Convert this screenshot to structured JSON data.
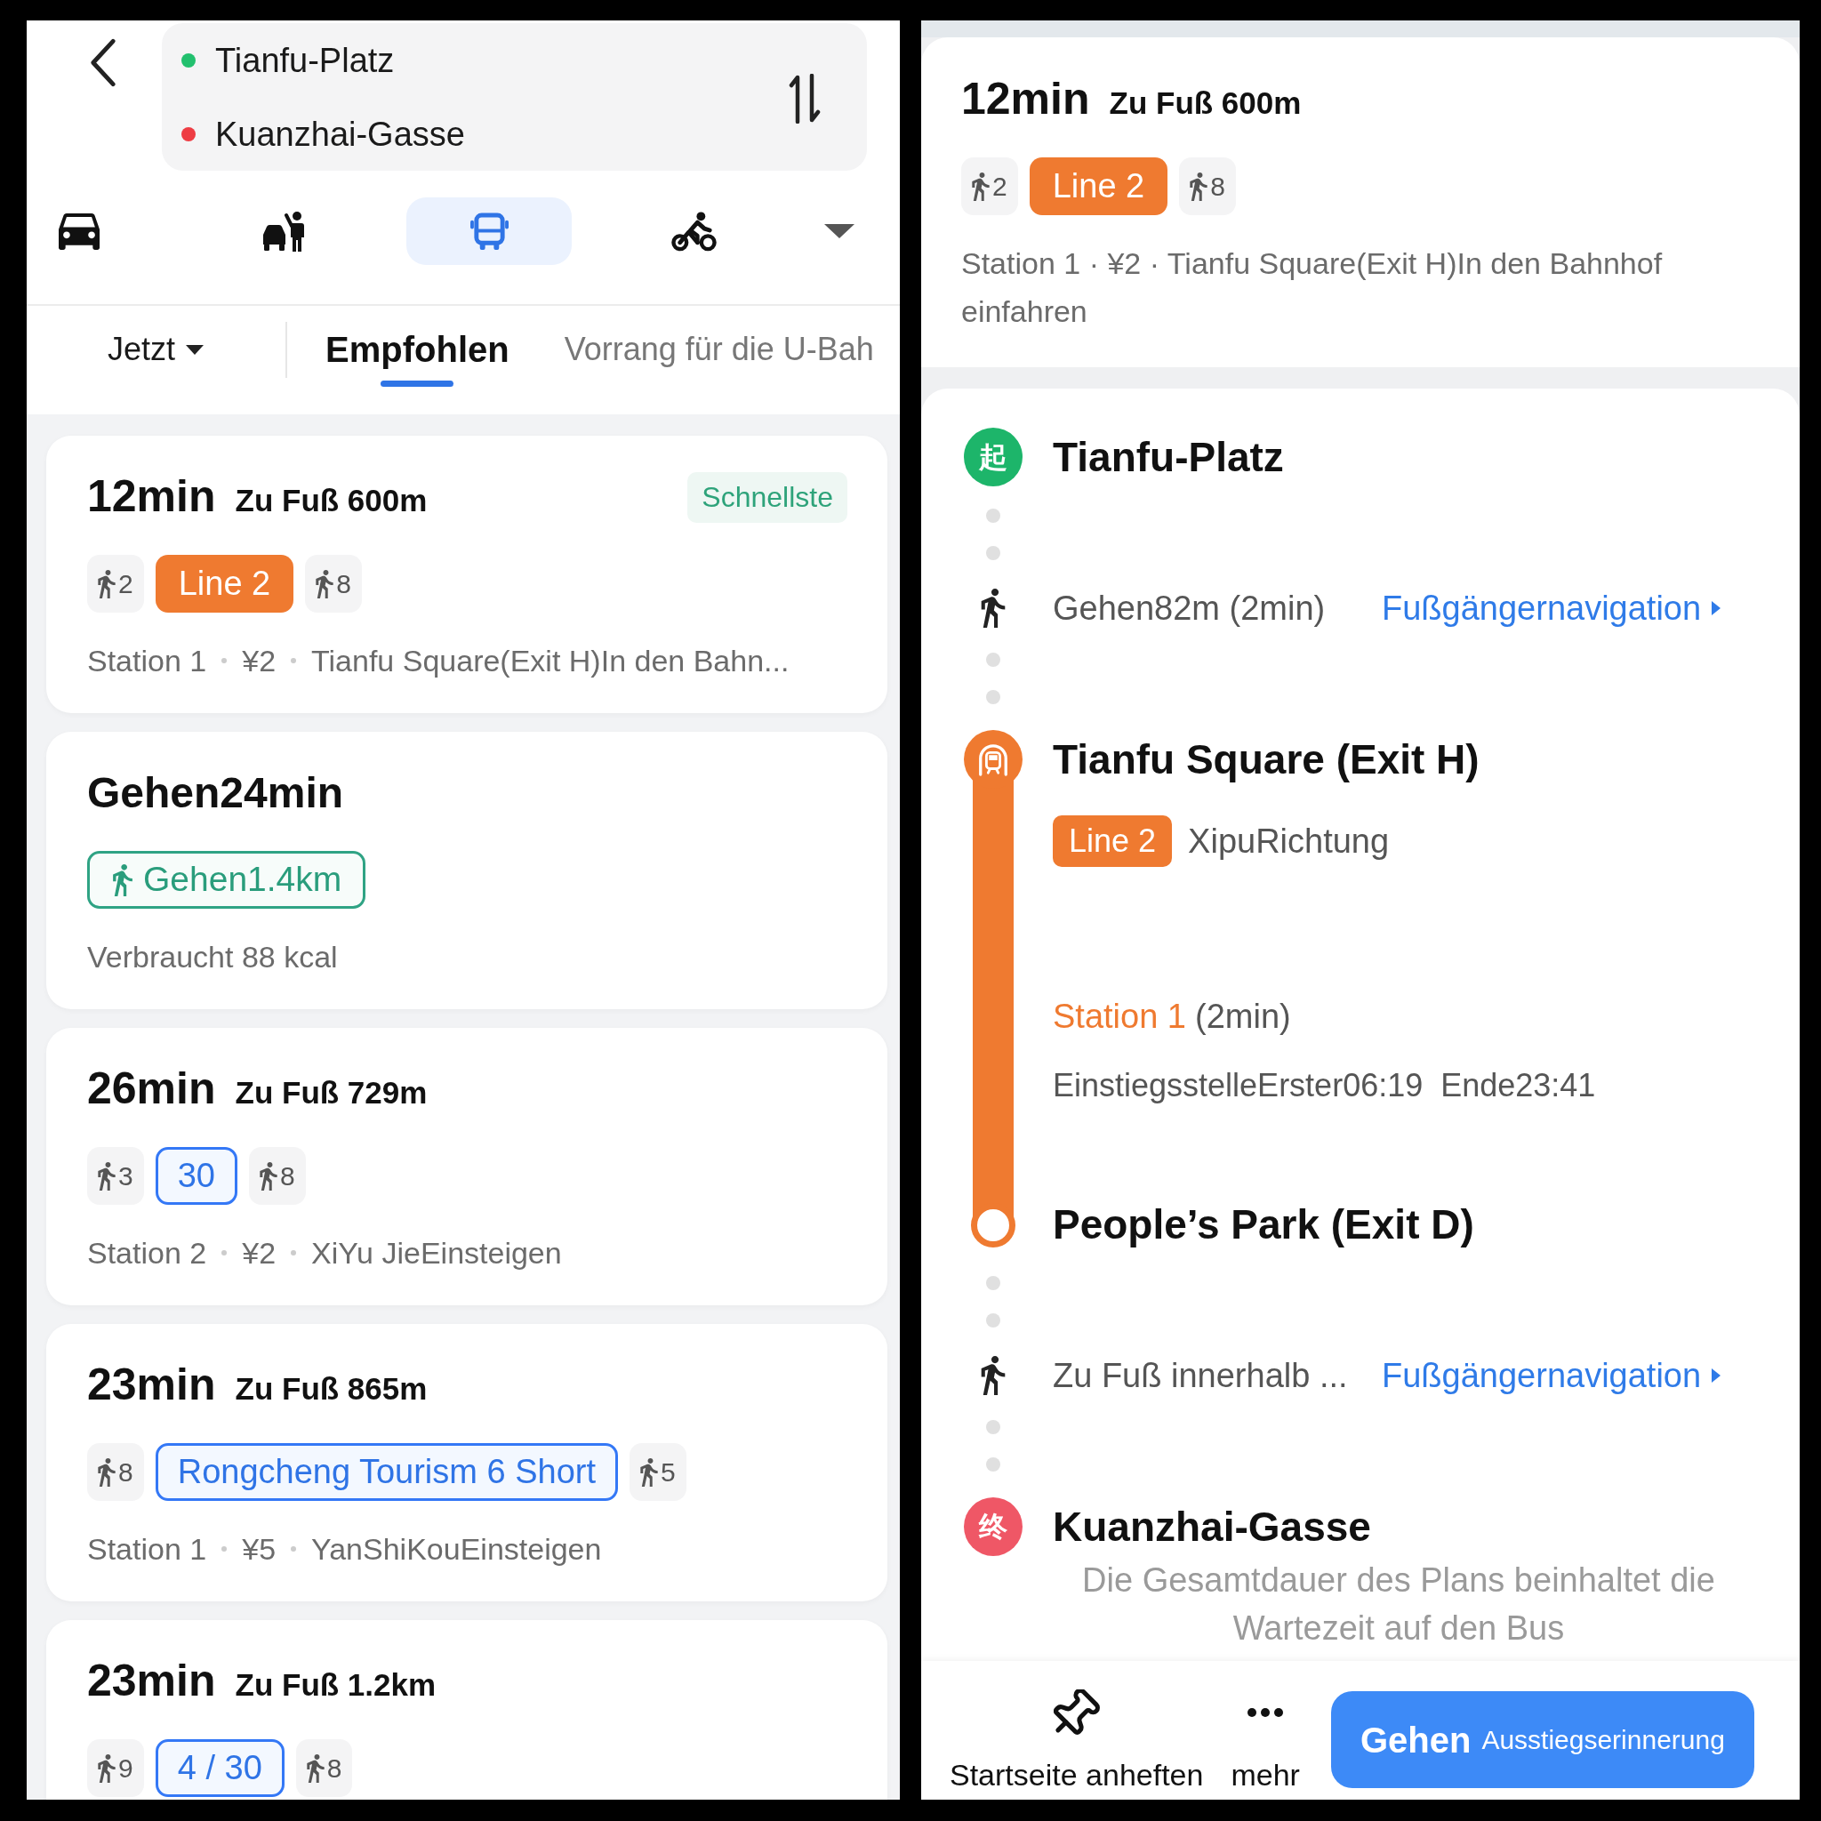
{
  "route_header": {
    "endpoints": [
      {
        "name": "Tianfu-Platz",
        "color": "#22c06e"
      },
      {
        "name": "Kuanzhai-Gasse",
        "color": "#ee3d44"
      }
    ]
  },
  "transport_modes": [
    {
      "kind": "car",
      "selected": false
    },
    {
      "kind": "taxi",
      "selected": false
    },
    {
      "kind": "bus",
      "selected": true
    },
    {
      "kind": "bike",
      "selected": false
    }
  ],
  "time_filter": "Jetzt",
  "sort_tabs": [
    {
      "label": "Empfohlen",
      "selected": true
    },
    {
      "label": "Vorrang für die U-Bah",
      "selected": false
    }
  ],
  "routes": [
    {
      "kind": "transit",
      "duration": "12min",
      "walk": "Zu Fuß 600m",
      "badge": "Schnellste",
      "segments": [
        {
          "kind": "walk",
          "label": "2"
        },
        {
          "kind": "metro",
          "label": "Line 2"
        },
        {
          "kind": "walk",
          "label": "8"
        }
      ],
      "meta": [
        "Station 1",
        "¥2",
        "Tianfu Square(Exit H)In den Bahn..."
      ]
    },
    {
      "kind": "walk",
      "title": "Gehen24min",
      "distance": "Gehen1.4km",
      "meta": [
        "Verbraucht 88 kcal"
      ]
    },
    {
      "kind": "transit",
      "duration": "26min",
      "walk": "Zu Fuß 729m",
      "segments": [
        {
          "kind": "walk",
          "label": "3"
        },
        {
          "kind": "bus",
          "label": "30"
        },
        {
          "kind": "walk",
          "label": "8"
        }
      ],
      "meta": [
        "Station 2",
        "¥2",
        "XiYu JieEinsteigen"
      ]
    },
    {
      "kind": "transit",
      "duration": "23min",
      "walk": "Zu Fuß 865m",
      "segments": [
        {
          "kind": "walk",
          "label": "8"
        },
        {
          "kind": "bus",
          "label": "Rongcheng Tourism 6 Short"
        },
        {
          "kind": "walk",
          "label": "5"
        }
      ],
      "meta": [
        "Station 1",
        "¥5",
        "YanShiKouEinsteigen"
      ]
    },
    {
      "kind": "transit",
      "duration": "23min",
      "walk": "Zu Fuß 1.2km",
      "segments": [
        {
          "kind": "walk",
          "label": "9"
        },
        {
          "kind": "bus",
          "label": "4 / 30"
        },
        {
          "kind": "walk",
          "label": "8"
        }
      ]
    }
  ],
  "detail": {
    "summary": {
      "duration": "12min",
      "walk": "Zu Fuß 600m",
      "segments": [
        {
          "kind": "walk",
          "label": "2"
        },
        {
          "kind": "metro",
          "label": "Line 2"
        },
        {
          "kind": "walk",
          "label": "8"
        }
      ],
      "meta_text": "Station 1 · ¥2 · Tianfu Square(Exit H)In den Bahnhof einfahren"
    },
    "steps": [
      {
        "kind": "start",
        "marker": "起",
        "name": "Tianfu-Platz"
      },
      {
        "kind": "walk",
        "text": "Gehen82m (2min)",
        "link": "Fußgängernavigation"
      },
      {
        "kind": "ride",
        "from": "Tianfu Square (Exit H)",
        "line": "Line 2",
        "direction": "XipuRichtung",
        "stops": "Station 1",
        "ride_time": "(2min)",
        "first": "EinstiegsstelleErster06:19",
        "last": "Ende23:41",
        "to": "People’s Park (Exit D)"
      },
      {
        "kind": "walk",
        "text": "Zu Fuß innerhalb ...",
        "link": "Fußgängernavigation"
      },
      {
        "kind": "end",
        "marker": "终",
        "name": "Kuanzhai-Gasse"
      }
    ],
    "note": "Die Gesamtdauer des Plans beinhaltet die Wartezeit auf den Bus",
    "actions": [
      {
        "kind": "pin",
        "label": "Startseite anheften"
      },
      {
        "kind": "more",
        "label": "mehr"
      }
    ],
    "primary_button": {
      "label": "Gehen",
      "sublabel": "Ausstiegserinnerung"
    }
  }
}
